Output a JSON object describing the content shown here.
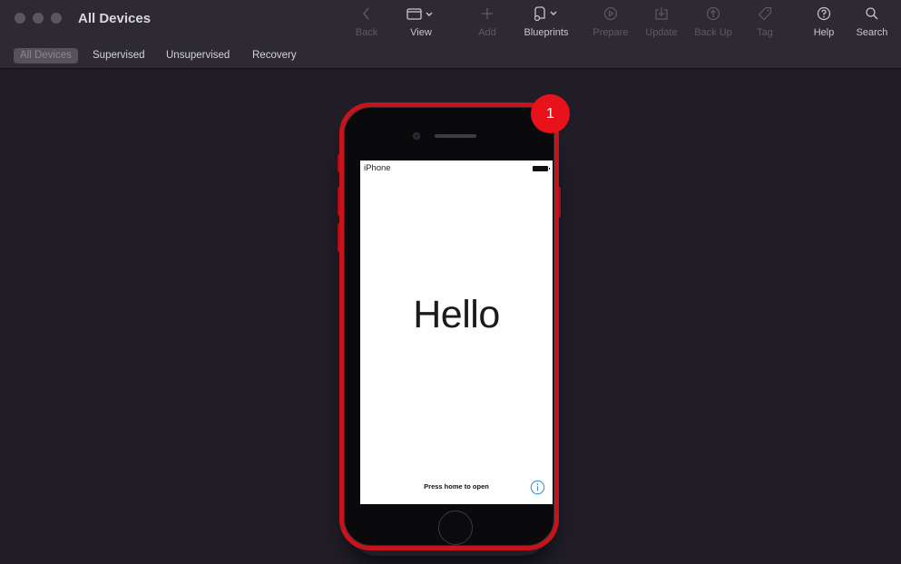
{
  "window": {
    "title": "All Devices",
    "traffic_lights": [
      "close",
      "minimize",
      "zoom"
    ]
  },
  "toolbar": {
    "items": [
      {
        "label": "Back",
        "icon": "chevron-left-icon",
        "enabled": false
      },
      {
        "label": "View",
        "icon": "view-icon",
        "enabled": true
      },
      {
        "label": "Add",
        "icon": "plus-icon",
        "enabled": false
      },
      {
        "label": "Blueprints",
        "icon": "blueprints-icon",
        "enabled": true
      },
      {
        "label": "Prepare",
        "icon": "prepare-icon",
        "enabled": false
      },
      {
        "label": "Update",
        "icon": "update-icon",
        "enabled": false
      },
      {
        "label": "Back Up",
        "icon": "backup-icon",
        "enabled": false
      },
      {
        "label": "Tag",
        "icon": "tag-icon",
        "enabled": false
      },
      {
        "label": "Help",
        "icon": "help-icon",
        "enabled": true
      },
      {
        "label": "Search",
        "icon": "search-icon",
        "enabled": true
      }
    ]
  },
  "filters": {
    "items": [
      {
        "label": "All Devices",
        "active": true
      },
      {
        "label": "Supervised",
        "active": false
      },
      {
        "label": "Unsupervised",
        "active": false
      },
      {
        "label": "Recovery",
        "active": false
      }
    ]
  },
  "device": {
    "carrier": "iPhone",
    "greeting": "Hello",
    "prompt": "Press home to open",
    "badge": "1",
    "color": "#c6141c"
  },
  "colors": {
    "background": "#201d27",
    "toolbar": "#2d2a34",
    "badge": "#e8121b",
    "info_blue": "#3a8ee6"
  }
}
